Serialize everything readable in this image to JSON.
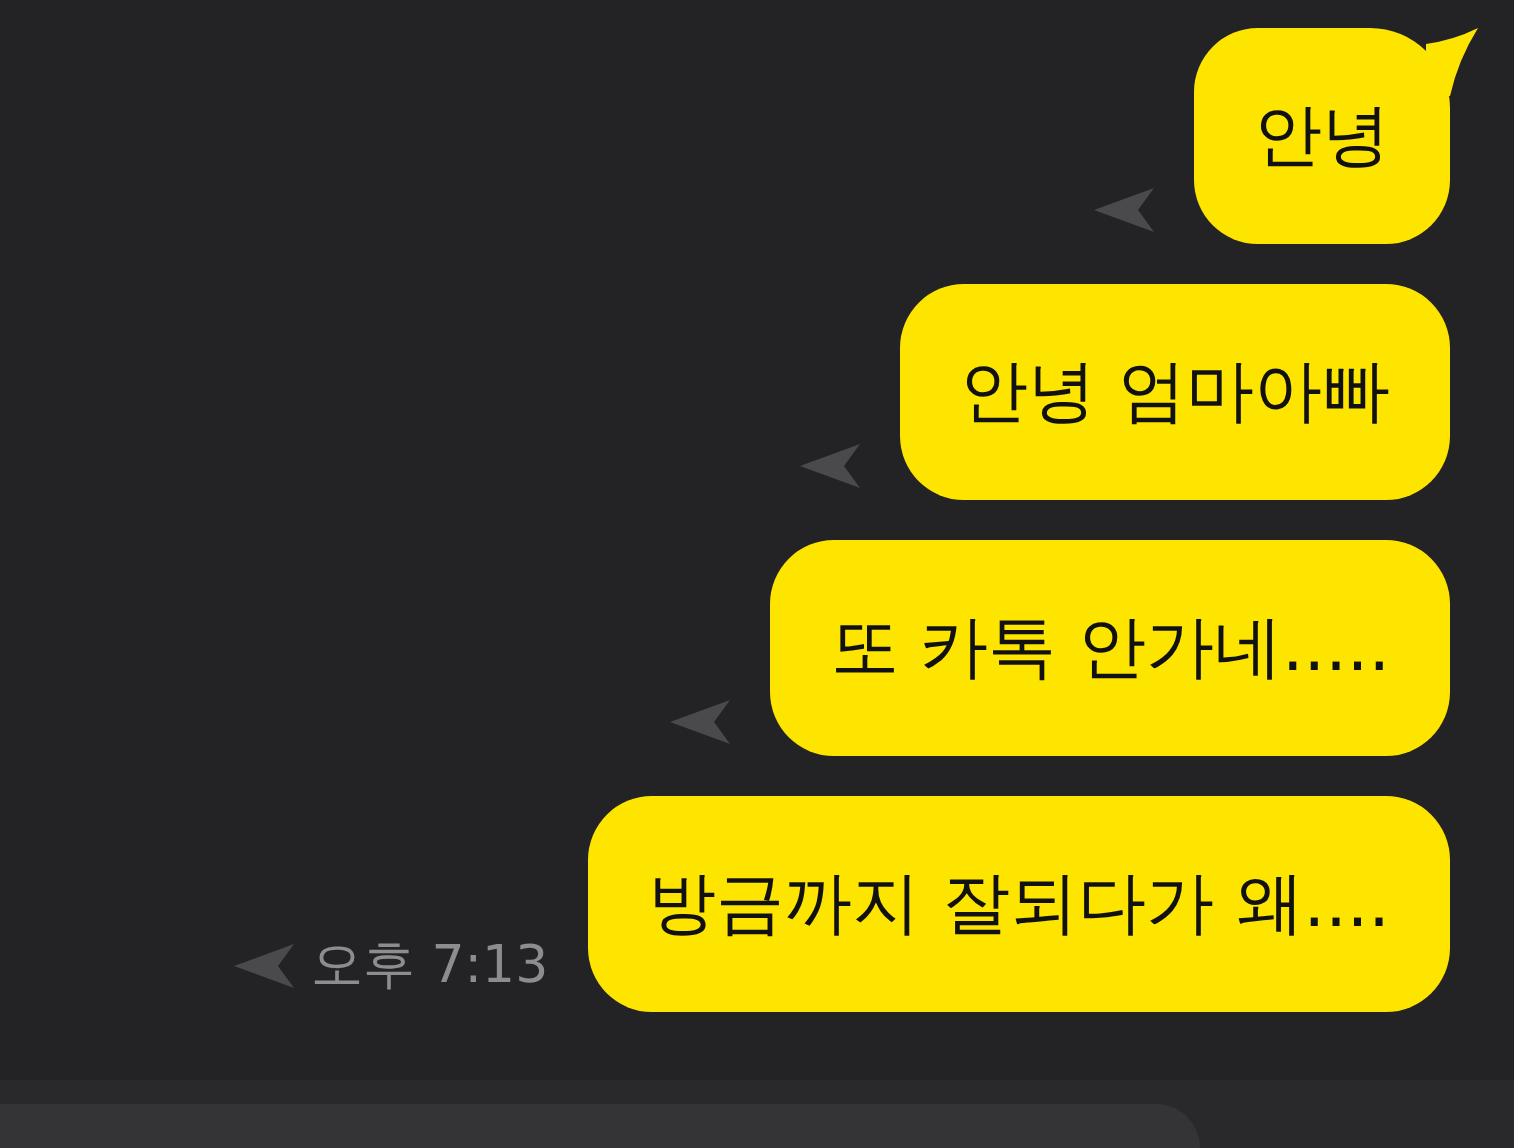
{
  "messages": [
    {
      "text": "안녕",
      "tail": true
    },
    {
      "text": "안녕 엄마아빠",
      "tail": false
    },
    {
      "text": "또 카톡 안가네.....",
      "tail": false
    },
    {
      "text": "방금까지 잘되다가 왜....",
      "tail": false,
      "time": "오후 7:13"
    }
  ]
}
